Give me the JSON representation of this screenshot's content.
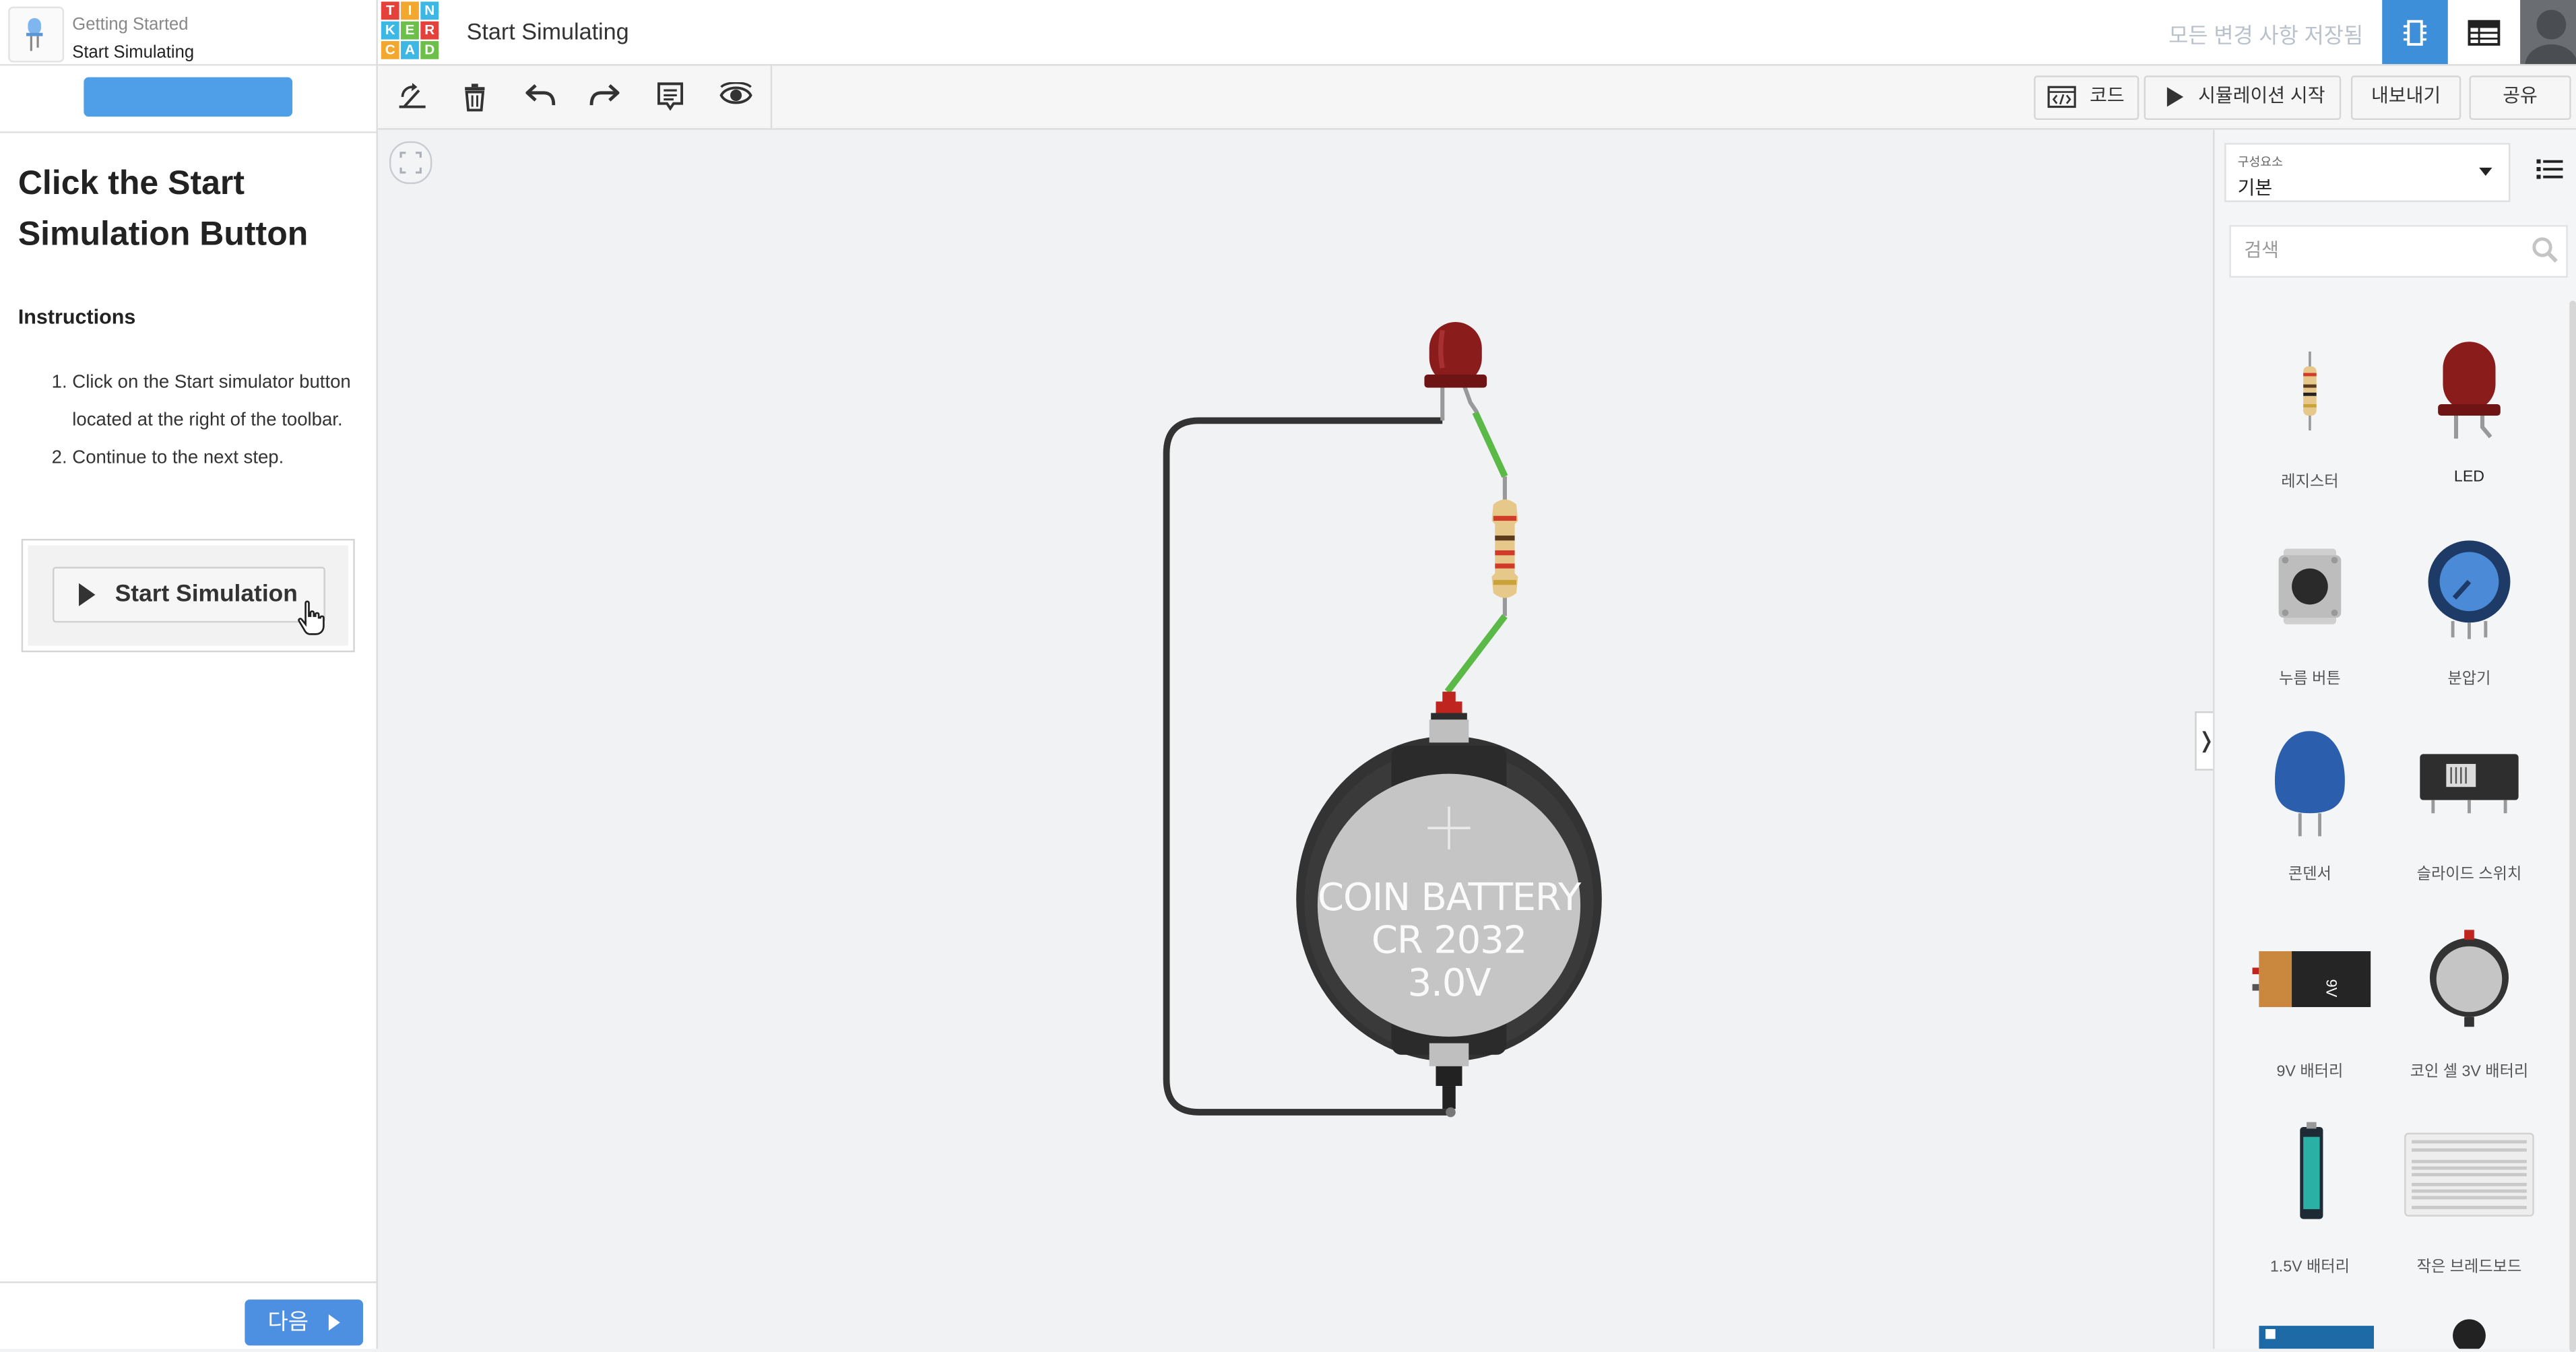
{
  "lesson": {
    "course": "Getting Started",
    "step": "Start Simulating",
    "title": "Click the Start Simulation Button",
    "instructions_heading": "Instructions",
    "instructions": [
      "Click on the Start simulator button located at the right of the toolbar.",
      "Continue to the next step."
    ],
    "demo_button_label": "Start Simulation",
    "next_label": "다음"
  },
  "header": {
    "logo_letters": [
      "T",
      "I",
      "N",
      "K",
      "E",
      "R",
      "C",
      "A",
      "D"
    ],
    "design_title": "Start Simulating",
    "save_status": "모든 변경 사항 저장됨"
  },
  "toolbar": {
    "code_label": "코드",
    "start_simulation_label": "시뮬레이션 시작",
    "export_label": "내보내기",
    "share_label": "공유"
  },
  "canvas": {
    "battery_line1": "COIN BATTERY",
    "battery_line2": "CR 2032",
    "battery_line3": "3.0V"
  },
  "components_panel": {
    "category_label": "구성요소",
    "category_value": "기본",
    "search_placeholder": "검색",
    "items": [
      {
        "name": "레지스터",
        "icon": "resistor-icon"
      },
      {
        "name": "LED",
        "icon": "led-icon"
      },
      {
        "name": "누름 버튼",
        "icon": "pushbutton-icon"
      },
      {
        "name": "분압기",
        "icon": "potentiometer-icon"
      },
      {
        "name": "콘덴서",
        "icon": "capacitor-icon"
      },
      {
        "name": "슬라이드 스위치",
        "icon": "slide-switch-icon"
      },
      {
        "name": "9V 배터리",
        "icon": "battery-9v-icon"
      },
      {
        "name": "코인 셀 3V 배터리",
        "icon": "coin-cell-icon"
      },
      {
        "name": "1.5V 배터리",
        "icon": "battery-aa-icon"
      },
      {
        "name": "작은 브레드보드",
        "icon": "breadboard-icon"
      }
    ]
  },
  "colors": {
    "accent_blue": "#3d8fd9",
    "next_button": "#4d8fe0",
    "led_red": "#8b1c1c",
    "wire_green": "#5bb947",
    "wire_dark": "#333333"
  }
}
